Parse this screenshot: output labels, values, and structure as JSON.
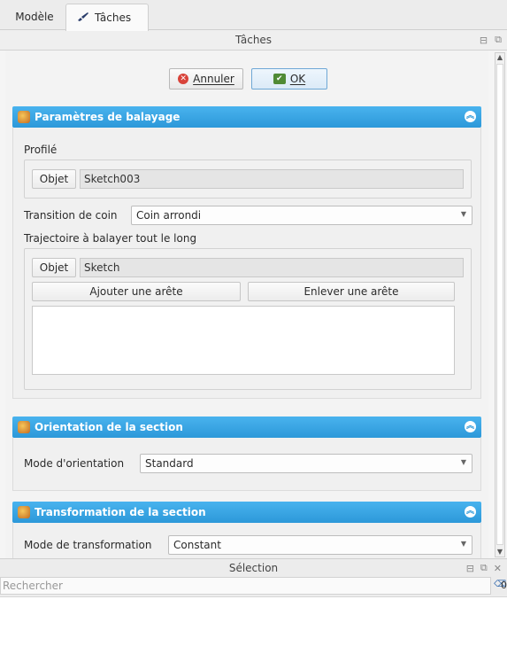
{
  "tabs": {
    "modele": "Modèle",
    "taches": "Tâches"
  },
  "task_panel": {
    "title": "Tâches",
    "buttons": {
      "cancel_label": "Annuler",
      "ok_label": "OK"
    },
    "sweep_params": {
      "header": "Paramètres de balayage",
      "profile_label": "Profilé",
      "profile_object_button": "Objet",
      "profile_value": "Sketch003",
      "corner_transition_label": "Transition de coin",
      "corner_transition_value": "Coin arrondi",
      "path_label": "Trajectoire à balayer tout le long",
      "path_object_button": "Objet",
      "path_value": "Sketch",
      "add_edge_button": "Ajouter une arête",
      "remove_edge_button": "Enlever une arête"
    },
    "orientation": {
      "header": "Orientation de la section",
      "mode_label": "Mode d'orientation",
      "mode_value": "Standard"
    },
    "transformation": {
      "header": "Transformation de la section",
      "mode_label": "Mode de transformation",
      "mode_value": "Constant"
    }
  },
  "selection_panel": {
    "title": "Sélection",
    "search_placeholder": "Rechercher",
    "count": "0"
  },
  "colors": {
    "group_header": "#2c98d9",
    "cancel_icon": "#d8433a",
    "ok_icon": "#4f8a35"
  }
}
